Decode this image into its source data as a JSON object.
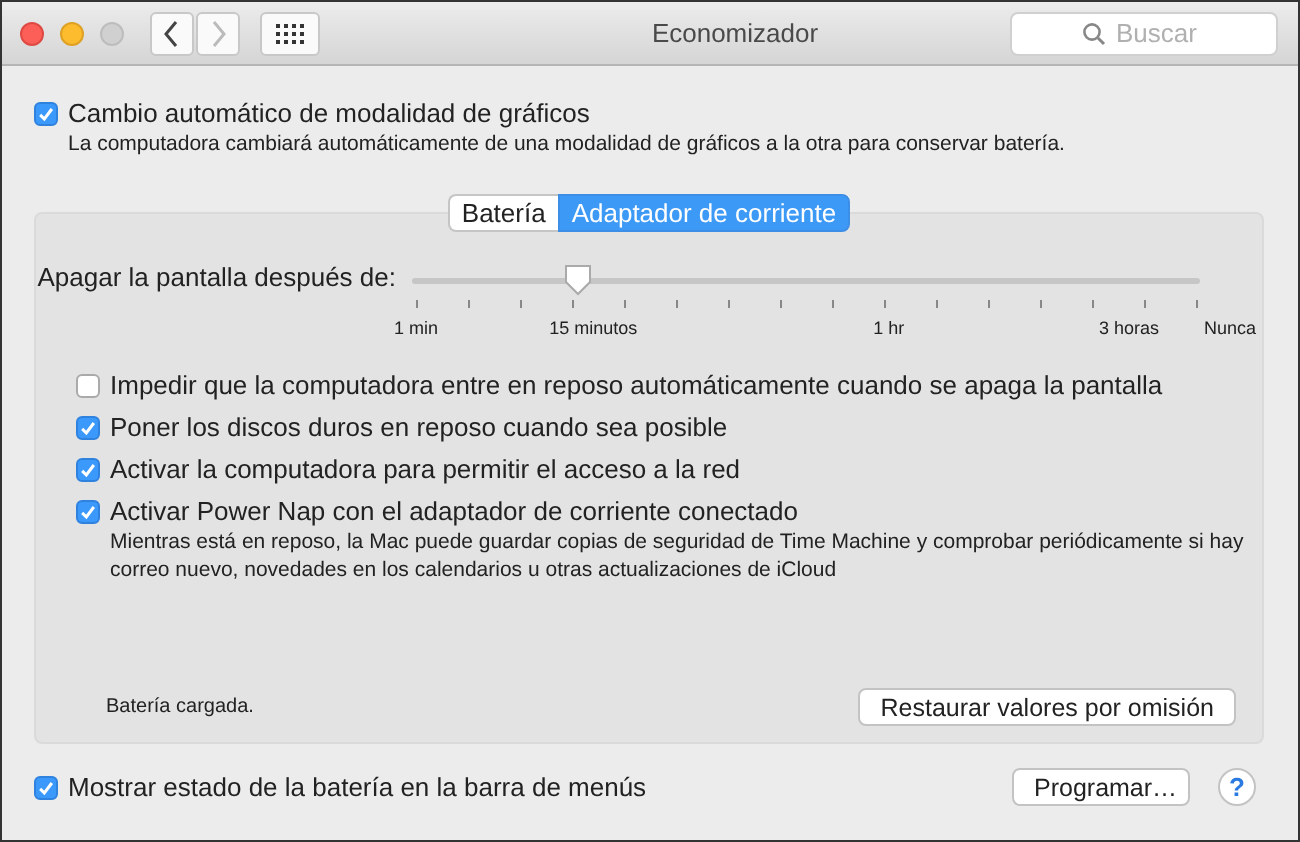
{
  "window": {
    "title": "Economizador"
  },
  "search": {
    "placeholder": "Buscar"
  },
  "graphics_switch": {
    "label": "Cambio automático de modalidad de gráficos",
    "checked": true,
    "description": "La computadora cambiará automáticamente de una modalidad de gráficos a la otra para conservar batería."
  },
  "tabs": [
    {
      "label": "Batería",
      "selected": false
    },
    {
      "label": "Adaptador de corriente",
      "selected": true
    }
  ],
  "display_sleep": {
    "label": "Apagar la pantalla después de:",
    "level": 0.21,
    "tick_labels": [
      "1 min",
      "15 minutos",
      "1 hr",
      "3 horas",
      "Nunca"
    ]
  },
  "options": [
    {
      "label": "Impedir que la computadora entre en reposo automáticamente cuando se apaga la pantalla",
      "checked": false
    },
    {
      "label": "Poner los discos duros en reposo cuando sea posible",
      "checked": true
    },
    {
      "label": "Activar la computadora para permitir el acceso a la red",
      "checked": true
    },
    {
      "label": "Activar Power Nap con el adaptador de corriente conectado",
      "checked": true,
      "description": "Mientras está en reposo, la Mac puede guardar copias de seguridad de Time Machine y comprobar periódicamente si hay correo nuevo, novedades en los calendarios u otras actualizaciones de iCloud"
    }
  ],
  "battery_status": "Batería cargada.",
  "restore_button": "Restaurar valores por omisión",
  "menu_bar_option": {
    "label": "Mostrar estado de la batería en la barra de menús",
    "checked": true
  },
  "schedule_button": "Programar…",
  "help_button": "?"
}
